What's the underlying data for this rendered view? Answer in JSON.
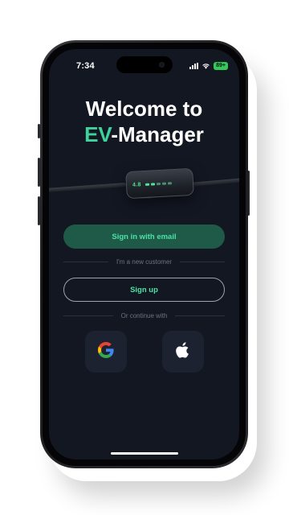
{
  "status_bar": {
    "time": "7:34",
    "battery": "89+"
  },
  "welcome": {
    "line1": "Welcome to",
    "brand_accent": "EV",
    "brand_rest": "-Manager"
  },
  "charger_image": {
    "display_text": "4.8"
  },
  "auth": {
    "sign_in_email_label": "Sign in with email",
    "new_customer_label": "I'm a new customer",
    "sign_up_label": "Sign up",
    "continue_with_label": "Or continue with"
  },
  "social": [
    {
      "icon": "google-icon"
    },
    {
      "icon": "apple-icon"
    }
  ],
  "colors": {
    "background": "#131722",
    "accent": "#3fd39c",
    "primary_button": "#1f5a49",
    "social_button": "#1c2230"
  }
}
